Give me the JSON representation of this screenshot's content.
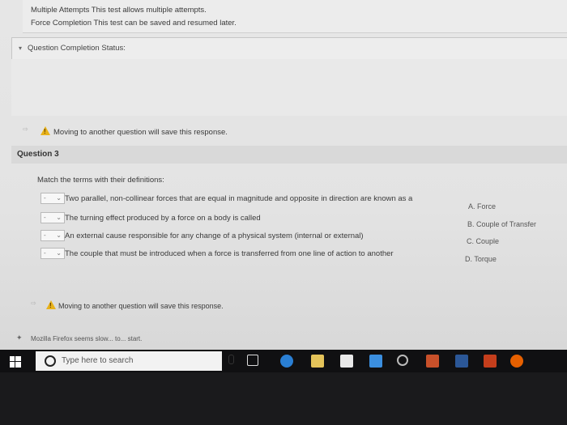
{
  "test_info": {
    "multiple_attempts": "Multiple Attempts  This test allows multiple attempts.",
    "force_completion": "Force Completion  This test can be saved and resumed later."
  },
  "status": {
    "toggle": "Question Completion Status:"
  },
  "warnings": {
    "top": "Moving to another question will save this response.",
    "bottom": "Moving to another question will save this response."
  },
  "question": {
    "title": "Question 3",
    "prompt": "Match the terms with their definitions:",
    "items": [
      {
        "selected": "-",
        "text": "Two parallel, non-collinear forces that are equal in magnitude and opposite in direction are known as a"
      },
      {
        "selected": "-",
        "text": "The turning effect produced by a force on a body is called"
      },
      {
        "selected": "-",
        "text": "An external cause responsible for any change of a physical system (internal or external)"
      },
      {
        "selected": "-",
        "text": "The couple that must be introduced when a force is transferred from one line of action to another"
      }
    ],
    "options": [
      "A. Force",
      "B. Couple of Transfer",
      "C. Couple",
      "D. Torque"
    ]
  },
  "browser_notice": "Mozilla Firefox seems slow... to... start.",
  "taskbar": {
    "search_placeholder": "Type here to search"
  },
  "colors": {
    "warning": "#e8b21a",
    "taskbar": "#101012",
    "edge_blue": "#2a7fd4"
  }
}
